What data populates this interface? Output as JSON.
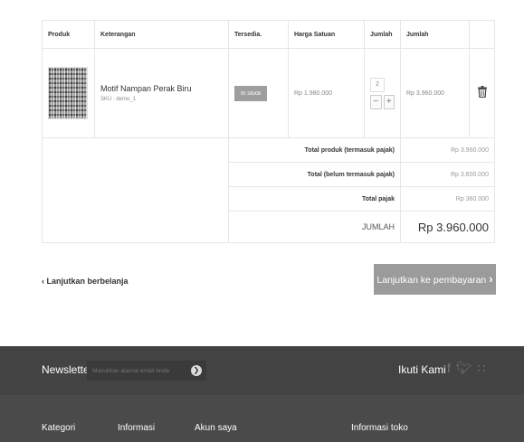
{
  "cart": {
    "headers": {
      "product": "Produk",
      "description": "Keterangan",
      "availability": "Tersedia.",
      "unit_price": "Harga Satuan",
      "qty": "Jumlah",
      "total": "Jumlah"
    },
    "item": {
      "name": "Motif Nampan Perak Biru",
      "sku": "SKU : demo_1",
      "availability": "In stock",
      "unit_price": "Rp 1.980.000",
      "quantity": "2",
      "total": "Rp 3.960.000",
      "minus": "−",
      "plus": "+",
      "delete_icon": "trash-icon"
    },
    "summary": [
      {
        "label": "Total produk (termasuk pajak)",
        "value": "Rp 3.960.000"
      },
      {
        "label": "Total (belum termasuk pajak)",
        "value": "Rp 3.600.000"
      },
      {
        "label": "Total pajak",
        "value": "Rp 360.000"
      }
    ],
    "grand_total": {
      "label": "JUMLAH",
      "value": "Rp 3.960.000"
    }
  },
  "actions": {
    "continue_shopping": "Lanjutkan berbelanja",
    "checkout": "Lanjutkan ke pembayaran"
  },
  "footer": {
    "newsletter_label": "Newsletter",
    "newsletter_placeholder": "Masukkan alamat email Anda",
    "follow_label": "Ikuti Kami",
    "social_icons": [
      "facebook-icon",
      "twitter-icon",
      "rss-icon"
    ],
    "columns": [
      "Kategori",
      "Informasi",
      "Akun saya",
      "Informasi toko"
    ]
  },
  "colors": {
    "button_gray": "#9b9b9b",
    "footer_bg": "#4a4a4a",
    "badge_gray": "#9e9e9e"
  }
}
